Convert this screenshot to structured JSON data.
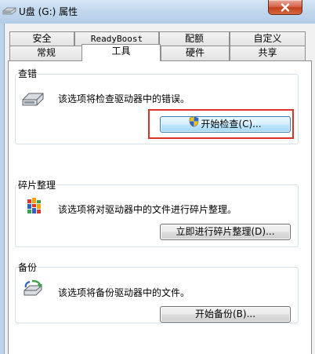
{
  "window": {
    "title": "U盘 (G:) 属性",
    "icon": "drive-icon",
    "close_icon": "close-icon"
  },
  "tabs_row1": [
    {
      "label": "安全"
    },
    {
      "label": "ReadyBoost"
    },
    {
      "label": "配额"
    },
    {
      "label": "自定义"
    }
  ],
  "tabs_row2": [
    {
      "label": "常规"
    },
    {
      "label": "工具",
      "active": true
    },
    {
      "label": "硬件"
    },
    {
      "label": "共享"
    }
  ],
  "error_check": {
    "group_label": "查错",
    "description": "该选项将检查驱动器中的错误。",
    "button_label": "开始检查(C)...",
    "icon": "drive-check-icon"
  },
  "defrag": {
    "group_label": "碎片整理",
    "description": "该选项将对驱动器中的文件进行碎片整理。",
    "button_label": "立即进行碎片整理(D)...",
    "icon": "defrag-icon"
  },
  "backup": {
    "group_label": "备份",
    "description": "该选项将备份驱动器中的文件。",
    "button_label": "开始备份(B)...",
    "icon": "backup-icon"
  },
  "colors": {
    "highlight": "#e0302a",
    "titlebar": "#c2d8ee",
    "close_button": "#d8694f"
  }
}
